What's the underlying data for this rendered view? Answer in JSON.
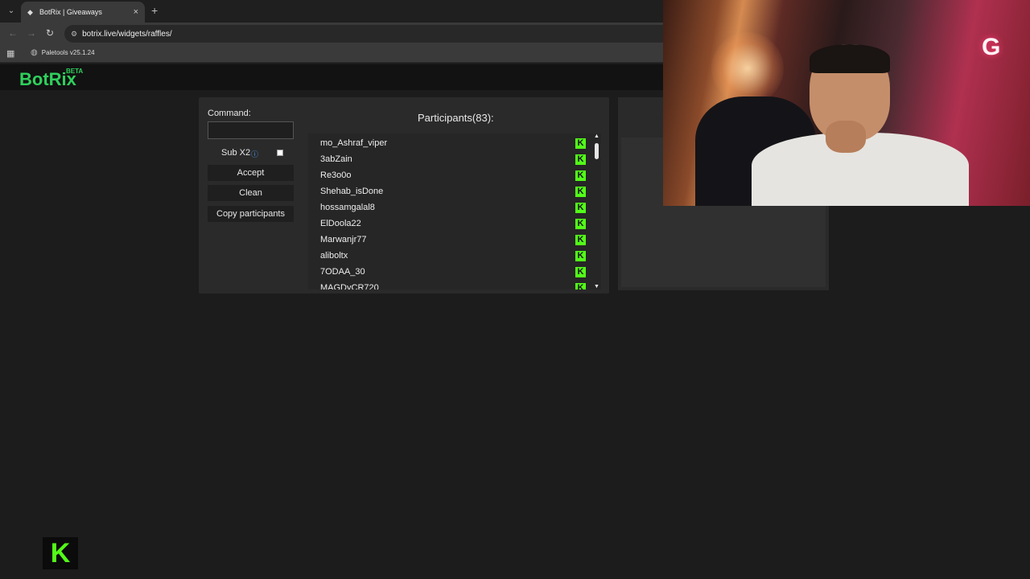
{
  "browser": {
    "tab_title": "BotRix | Giveaways",
    "tab_close": "×",
    "new_tab": "+",
    "url": "botrix.live/widgets/raffles/",
    "bookmark": "Paletools v25.1.24"
  },
  "header": {
    "logo": "BotRix",
    "badge": "BETA"
  },
  "command": {
    "label": "Command:",
    "value": ""
  },
  "sub_x2": {
    "label": "Sub X2",
    "checked": false
  },
  "buttons": {
    "accept": "Accept",
    "clean": "Clean",
    "copy": "Copy participants"
  },
  "participants": {
    "title": "Participants(83):",
    "items": [
      "mo_Ashraf_viper",
      "3abZain",
      "Re3o0o",
      "Shehab_isDone",
      "hossamgalal8",
      "ElDoola22",
      "Marwanjr77",
      "aliboltx",
      "7ODAA_30",
      "MAGDyCR720"
    ]
  },
  "icons": {
    "kick": "kick-icon",
    "kick_letter": "K",
    "kick_color": "#53fc18",
    "brand_color": "#2fd05c"
  },
  "webcam": {
    "sign": "G"
  }
}
